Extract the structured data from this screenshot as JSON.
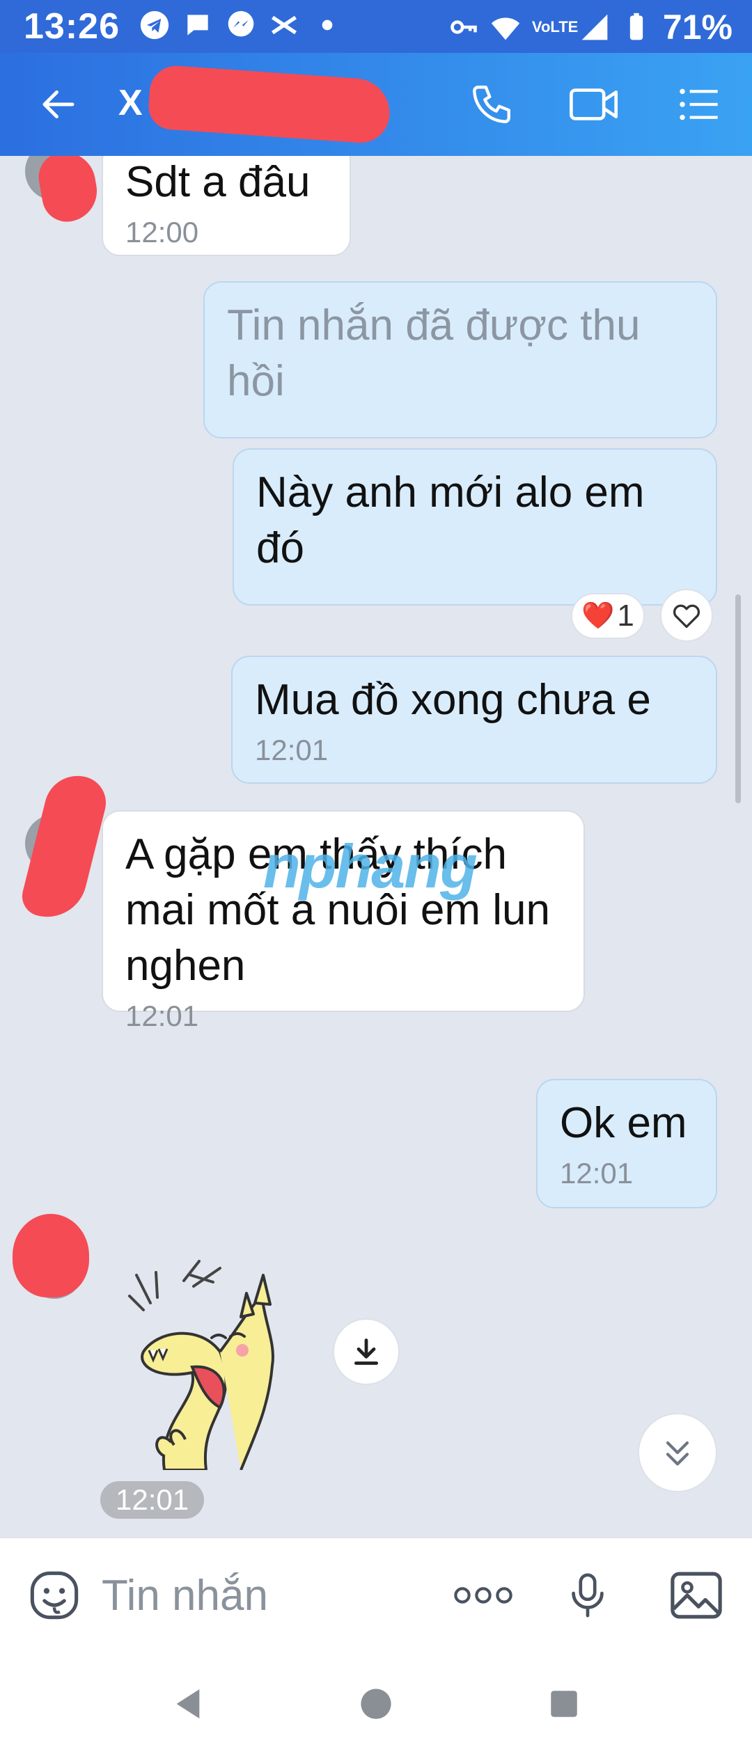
{
  "status_bar": {
    "time": "13:26",
    "network": "VoLTE",
    "battery": "71%",
    "icons": [
      "telegram-icon",
      "chat-bubble-icon",
      "messenger-icon",
      "capcut-icon",
      "dot-icon",
      "key-icon",
      "wifi-icon",
      "signal-icon",
      "battery-icon"
    ]
  },
  "header": {
    "contact_name": "X",
    "icons": [
      "back-arrow-icon",
      "phone-icon",
      "video-call-icon",
      "menu-list-icon"
    ]
  },
  "messages": [
    {
      "id": "m1",
      "side": "in",
      "text": "Sdt a đâu",
      "time": "12:00"
    },
    {
      "id": "m2",
      "side": "out",
      "text": "Tin nhắn đã được thu hồi",
      "recalled": true,
      "time": ""
    },
    {
      "id": "m3",
      "side": "out",
      "text": "Này anh mới alo em đó",
      "time": "",
      "reaction": {
        "emoji": "❤️",
        "count": "1"
      }
    },
    {
      "id": "m4",
      "side": "out",
      "text": "Mua đồ xong chưa e",
      "time": "12:01"
    },
    {
      "id": "m5",
      "side": "in",
      "text": "A gặp em thấy thích mai mốt a nuôi em lun nghen",
      "time": "12:01"
    },
    {
      "id": "m6",
      "side": "out",
      "text": "Ok em",
      "time": "12:01"
    },
    {
      "id": "m7",
      "side": "in",
      "type": "sticker",
      "sticker": "laughing-yellow-dinosaur",
      "time": "12:01"
    }
  ],
  "watermark": "nphang",
  "input_bar": {
    "placeholder": "Tin nhắn",
    "icons": [
      "emoji-icon",
      "more-dots-icon",
      "microphone-icon",
      "image-gallery-icon"
    ]
  },
  "nav_bar": {
    "icons": [
      "back-triangle-icon",
      "home-circle-icon",
      "recents-square-icon"
    ]
  },
  "colors": {
    "header_start": "#2c6fe0",
    "header_end": "#3aa2f3",
    "chat_background": "#e2e6ee",
    "outgoing_bubble": "#d8ecfc",
    "incoming_bubble": "#ffffff",
    "redaction": "#f54b55"
  }
}
